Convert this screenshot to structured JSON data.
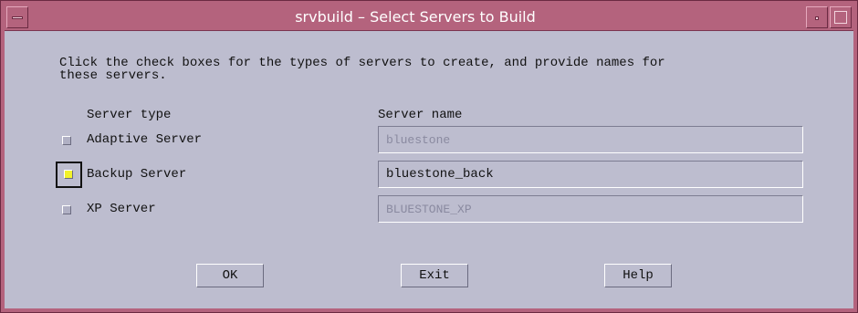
{
  "window": {
    "title": "srvbuild – Select Servers to Build"
  },
  "instruction": "Click the check boxes for the types of servers to create, and provide names for\nthese servers.",
  "columns": {
    "server_type": "Server type",
    "server_name": "Server name"
  },
  "servers": [
    {
      "type_label": "Adaptive Server",
      "name_value": "bluestone",
      "checked": false
    },
    {
      "type_label": "Backup Server",
      "name_value": "bluestone_back",
      "checked": true
    },
    {
      "type_label": "XP Server",
      "name_value": "BLUESTONE_XP",
      "checked": false
    }
  ],
  "buttons": {
    "ok": "OK",
    "exit": "Exit",
    "help": "Help"
  },
  "colors": {
    "titlebar": "#b4637d",
    "window_bg": "#bdbdcf",
    "checked_fill": "#f2f22a"
  }
}
